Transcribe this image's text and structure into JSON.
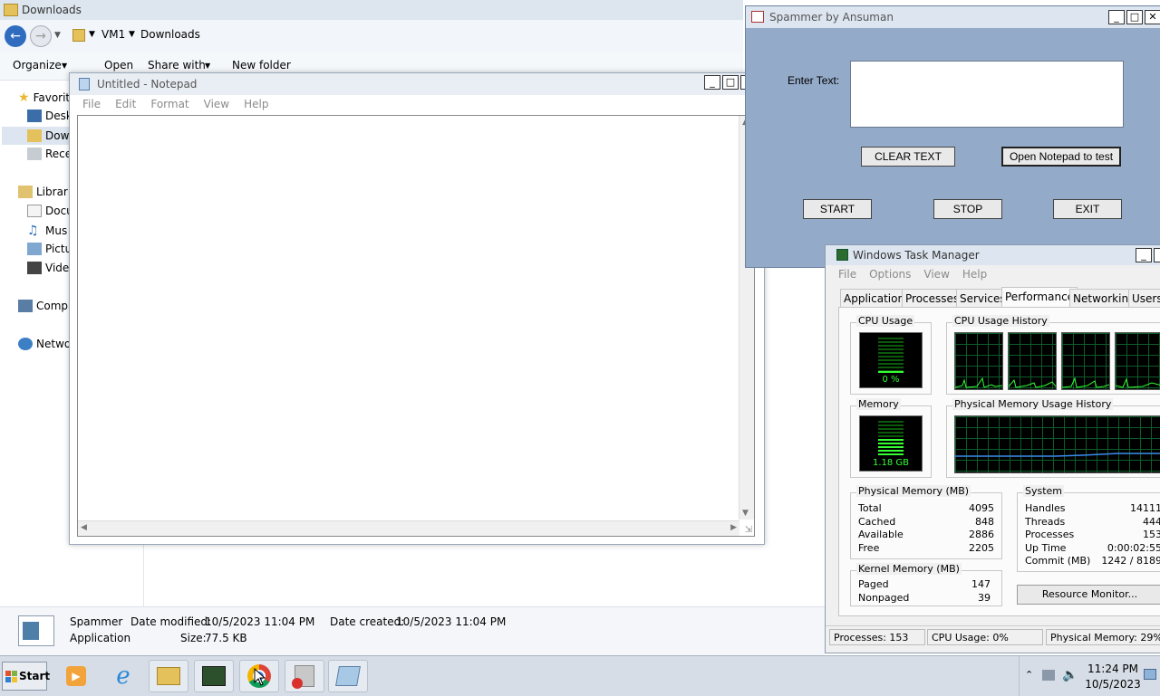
{
  "explorer": {
    "title": "Downloads",
    "breadcrumb": [
      "VM1",
      "Downloads"
    ],
    "toolbar": {
      "organize": "Organize",
      "open": "Open",
      "share": "Share with",
      "new_folder": "New folder"
    },
    "nav": {
      "favorites": "Favorit",
      "desktop": "Desk",
      "downloads": "Dow",
      "recent": "Rece",
      "libraries": "Librari",
      "documents": "Docu",
      "music": "Mus",
      "pictures": "Pictu",
      "videos": "Vide",
      "computer": "Comp",
      "network": "Netwo"
    },
    "details": {
      "name": "Spammer",
      "type": "Application",
      "modified_label": "Date modified:",
      "modified": "10/5/2023 11:04 PM",
      "created_label": "Date created:",
      "created": "10/5/2023 11:04 PM",
      "size_label": "Size:",
      "size": "77.5 KB"
    }
  },
  "notepad": {
    "title": "Untitled - Notepad",
    "menu": [
      "File",
      "Edit",
      "Format",
      "View",
      "Help"
    ],
    "content": ""
  },
  "spammer": {
    "title": "Spammer by Ansuman",
    "enter_text_label": "Enter Text:",
    "text_value": "",
    "clear_button": "CLEAR TEXT",
    "open_notepad_button": "Open Notepad to test",
    "start_button": "START",
    "stop_button": "STOP",
    "exit_button": "EXIT"
  },
  "taskmgr": {
    "title": "Windows Task Manager",
    "menu": [
      "File",
      "Options",
      "View",
      "Help"
    ],
    "tabs": [
      "Applications",
      "Processes",
      "Services",
      "Performance",
      "Networking",
      "Users"
    ],
    "active_tab": "Performance",
    "cpu_usage_label": "CPU Usage",
    "cpu_usage_value": "0 %",
    "cpu_history_label": "CPU Usage History",
    "memory_label": "Memory",
    "memory_value": "1.18 GB",
    "mem_history_label": "Physical Memory Usage History",
    "physical_memory": {
      "label": "Physical Memory (MB)",
      "rows": [
        {
          "k": "Total",
          "v": "4095"
        },
        {
          "k": "Cached",
          "v": "848"
        },
        {
          "k": "Available",
          "v": "2886"
        },
        {
          "k": "Free",
          "v": "2205"
        }
      ]
    },
    "kernel_memory": {
      "label": "Kernel Memory (MB)",
      "rows": [
        {
          "k": "Paged",
          "v": "147"
        },
        {
          "k": "Nonpaged",
          "v": "39"
        }
      ]
    },
    "system": {
      "label": "System",
      "rows": [
        {
          "k": "Handles",
          "v": "14111"
        },
        {
          "k": "Threads",
          "v": "444"
        },
        {
          "k": "Processes",
          "v": "153"
        },
        {
          "k": "Up Time",
          "v": "0:00:02:55"
        },
        {
          "k": "Commit (MB)",
          "v": "1242 / 8189"
        }
      ]
    },
    "resource_monitor_button": "Resource Monitor...",
    "status": {
      "processes": "Processes: 153",
      "cpu": "CPU Usage: 0%",
      "memory": "Physical Memory: 29%"
    },
    "colors": {
      "graph_green": "#33ff33",
      "memory_line": "#3a8df0"
    }
  },
  "taskbar": {
    "start_label": "Start",
    "time": "11:24 PM",
    "date": "10/5/2023"
  }
}
